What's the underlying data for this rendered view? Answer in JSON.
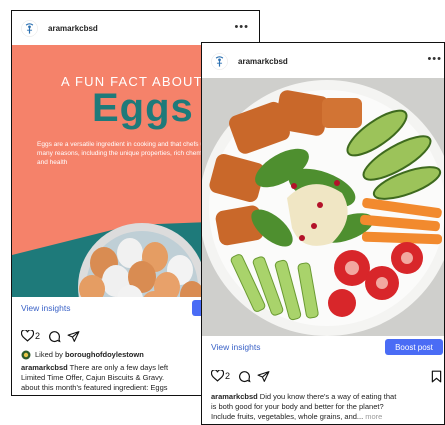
{
  "back_post": {
    "username": "aramarkcbsd",
    "image": {
      "kicker": "A FUN FACT ABOUT",
      "title": "Eggs",
      "body": "Eggs are a versatile ingredient in cooking and that chefs use for many reasons, including the unique properties, rich chemistry, and health"
    },
    "view_insights": "View insights",
    "boost_label": "B",
    "like_count": "2",
    "liked_by_prefix": "Liked by",
    "liked_by_user": "boroughofdoylestown",
    "caption_user": "aramarkcbsd",
    "caption_line1": "There are only a few days left",
    "caption_line2": "Limited Time Offer, Cajun Biscuits & Gravy.",
    "caption_line3": "about this month's featured ingredient: Eggs"
  },
  "front_post": {
    "username": "aramarkcbsd",
    "view_insights": "View insights",
    "boost_label": "Boost post",
    "like_count": "2",
    "caption_user": "aramarkcbsd",
    "caption_line1": "Did you know there's a way of eating that",
    "caption_line2": "is both good for your body and better for the planet?",
    "caption_line3": "Include fruits, vegetables, whole grains, and...",
    "more_label": "more"
  },
  "icons": {
    "more": "more-dots-icon",
    "like": "heart-icon",
    "comment": "comment-icon",
    "share": "paper-plane-icon",
    "save": "bookmark-icon"
  },
  "colors": {
    "coral": "#f5826a",
    "teal": "#1e7a7a",
    "link_blue": "#3a62c7",
    "boost_blue": "#4a6cf5"
  }
}
